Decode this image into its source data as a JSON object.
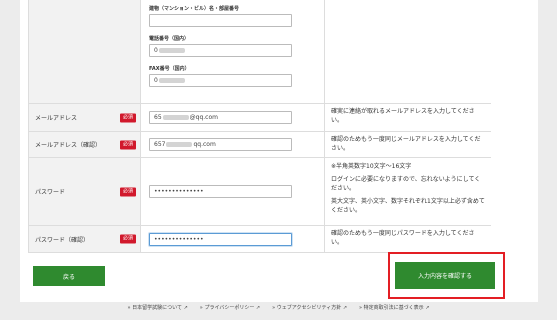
{
  "address": {
    "building_label": "建物（マンション・ビル）名・部屋番号",
    "phone_label": "電話番号（国内）",
    "phone_value": "0",
    "fax_label": "FAX番号（国内）",
    "fax_value": "0"
  },
  "email": {
    "label": "メールアドレス",
    "required": "必須",
    "value_prefix": "65",
    "value_suffix": "@qq.com",
    "note": "確実に連絡が取れるメールアドレスを入力してください。"
  },
  "email_confirm": {
    "label": "メールアドレス（確認）",
    "required": "必須",
    "value_prefix": "657",
    "value_suffix": "qq.com",
    "note": "確認のためもう一度同じメールアドレスを入力してください。"
  },
  "password": {
    "label": "パスワード",
    "required": "必須",
    "value": "••••••••••••••",
    "note1": "※半角英数字10文字～16文字",
    "note2": "ログインに必要になりますので、忘れないようにしてください。",
    "note3": "英大文字、英小文字、数字それぞれ1文字以上必ず含めてください。"
  },
  "password_confirm": {
    "label": "パスワード（確認）",
    "required": "必須",
    "value": "••••••••••••••",
    "note": "確認のためもう一度同じパスワードを入力してください。"
  },
  "buttons": {
    "back": "戻る",
    "confirm": "入力内容を確認する"
  },
  "footer": {
    "links": [
      "» 日本留学試験について ↗",
      "» プライバシーポリシー ↗",
      "» ウェブアクセシビリティ方針 ↗",
      "» 特定商取引法に基づく表示 ↗"
    ]
  },
  "colors": {
    "accent_green": "#2f8a2f",
    "required_red": "#d1192c",
    "highlight_red": "#e31e24"
  }
}
